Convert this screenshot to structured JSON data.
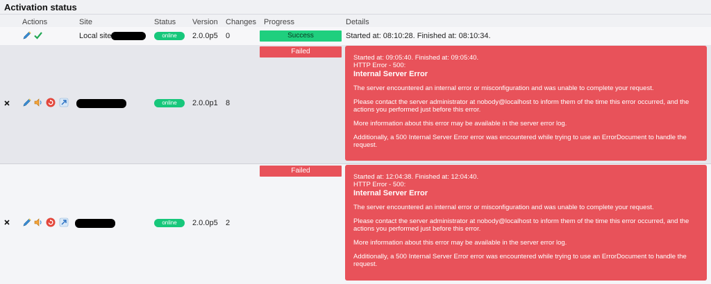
{
  "page": {
    "title": "Activation status"
  },
  "table": {
    "headers": [
      "Actions",
      "Site",
      "Status",
      "Version",
      "Changes",
      "Progress",
      "Details"
    ]
  },
  "rows": [
    {
      "site": "Local site",
      "status": "online",
      "version": "2.0.0p5",
      "changes": "0",
      "progress": "Success",
      "details": "Started at: 08:10:28. Finished at: 08:10:34."
    },
    {
      "status": "online",
      "version": "2.0.0p1",
      "changes": "8",
      "progress": "Failed",
      "error": {
        "timing": "Started at: 09:05:40. Finished at: 09:05:40.",
        "http": "HTTP Error - 500:",
        "heading": "Internal Server Error",
        "p1": "The server encountered an internal error or misconfiguration and was unable to complete your request.",
        "p2": "Please contact the server administrator at nobody@localhost to inform them of the time this error occurred, and the actions you performed just before this error.",
        "p3": "More information about this error may be available in the server error log.",
        "p4": "Additionally, a 500 Internal Server Error error was encountered while trying to use an ErrorDocument to handle the request."
      }
    },
    {
      "status": "online",
      "version": "2.0.0p5",
      "changes": "2",
      "progress": "Failed",
      "error": {
        "timing": "Started at: 12:04:38. Finished at: 12:04:40.",
        "http": "HTTP Error - 500:",
        "heading": "Internal Server Error",
        "p1": "The server encountered an internal error or misconfiguration and was unable to complete your request.",
        "p2": "Please contact the server administrator at nobody@localhost to inform them of the time this error occurred, and the actions you performed just before this error.",
        "p3": "More information about this error may be available in the server error log.",
        "p4": "Additionally, a 500 Internal Server Error error was encountered while trying to use an ErrorDocument to handle the request."
      }
    }
  ],
  "colors": {
    "success": "#1fcf7e",
    "failed": "#e8525a",
    "online": "#17c77b"
  }
}
